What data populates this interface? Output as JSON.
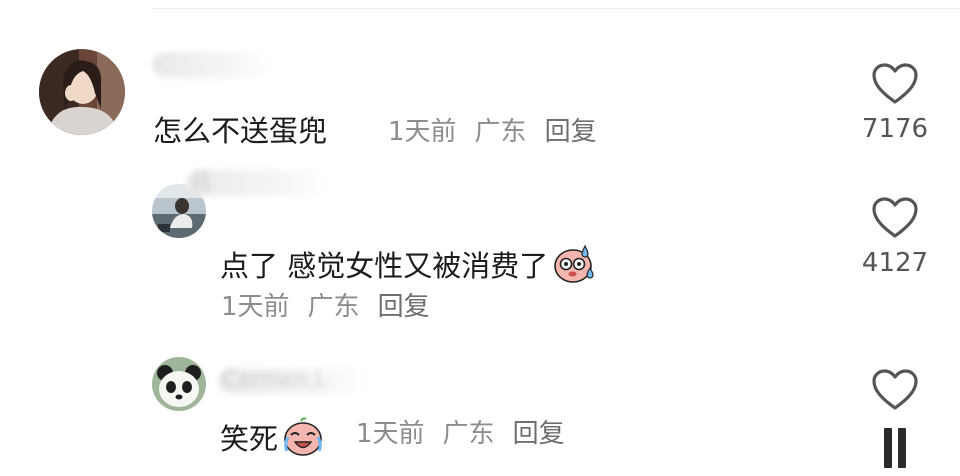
{
  "comments": [
    {
      "username": "·",
      "text": "怎么不送蛋兜",
      "time": "1天前",
      "location": "广东",
      "reply_label": "回复",
      "like_count": "7176",
      "emoji": ""
    },
    {
      "username": "吕",
      "text": "点了 感觉女性又被消费了",
      "time": "1天前",
      "location": "广东",
      "reply_label": "回复",
      "like_count": "4127",
      "emoji": "sweat-face-emoji"
    },
    {
      "username": "Carmen.L",
      "text": "笑死",
      "time": "1天前",
      "location": "广东",
      "reply_label": "回复",
      "like_count": "",
      "emoji": "laugh-cry-emoji"
    }
  ],
  "colors": {
    "text": "#1c1c1c",
    "meta": "#8d8d8d",
    "icon": "#555555"
  }
}
